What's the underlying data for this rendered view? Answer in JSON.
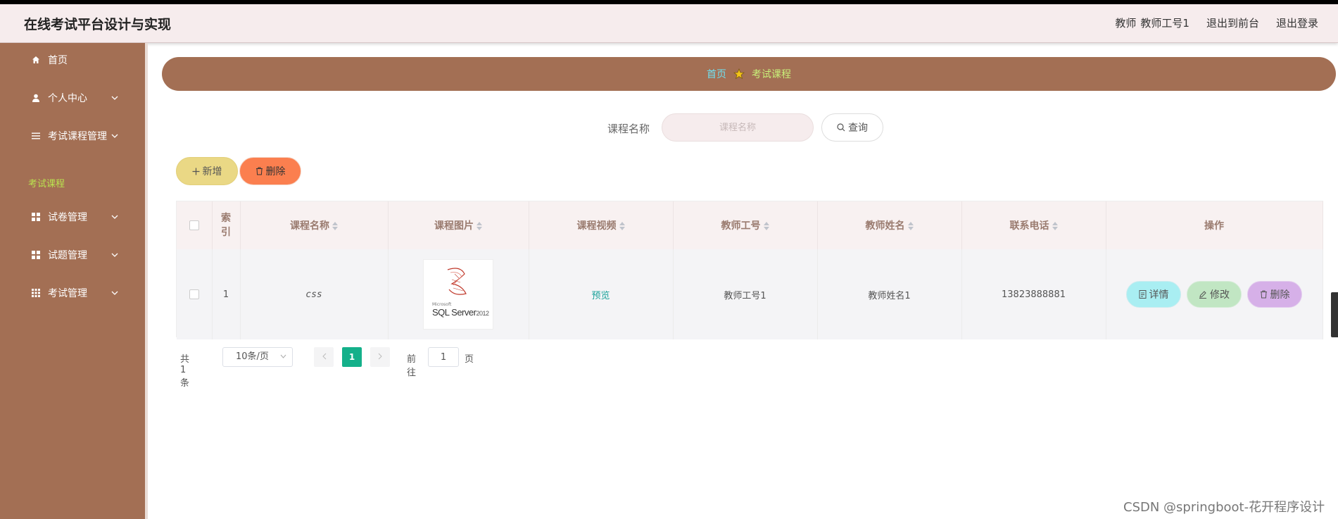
{
  "header": {
    "title": "在线考试平台设计与实现",
    "user_role": "教师",
    "user_name": "教师工号1",
    "back_to_front": "退出到前台",
    "logout": "退出登录"
  },
  "sidebar": {
    "items": [
      {
        "label": "首页",
        "icon": "home-icon"
      },
      {
        "label": "个人中心",
        "icon": "user-icon"
      },
      {
        "label": "考试课程管理",
        "icon": "list-icon"
      },
      {
        "label": "试卷管理",
        "icon": "grid-icon"
      },
      {
        "label": "试题管理",
        "icon": "grid-icon"
      },
      {
        "label": "考试管理",
        "icon": "grid9-icon"
      }
    ],
    "active_sub": "考试课程"
  },
  "breadcrumb": {
    "home": "首页",
    "current": "考试课程"
  },
  "search": {
    "label": "课程名称",
    "placeholder": "课程名称",
    "button": "查询"
  },
  "actions": {
    "add": "新增",
    "delete": "删除"
  },
  "table": {
    "headers": [
      "索引",
      "课程名称",
      "课程图片",
      "课程视频",
      "教师工号",
      "教师姓名",
      "联系电话",
      "操作"
    ],
    "rows": [
      {
        "index": "1",
        "course_name": "css",
        "image_sub": "Microsoft",
        "image_main": "SQL Server",
        "image_ver": "2012",
        "video": "预览",
        "teacher_id": "教师工号1",
        "teacher_name": "教师姓名1",
        "phone": "13823888881",
        "ops": {
          "detail": "详情",
          "edit": "修改",
          "delete": "删除"
        }
      }
    ]
  },
  "pager": {
    "total": "共 1 条",
    "size": "10条/页",
    "current": "1",
    "goto": "前往",
    "goto_value": "1",
    "page_unit": "页"
  },
  "watermark": "CSDN @springboot-花开程序设计",
  "colors": {
    "sidebar": "#a36f54",
    "header": "#f6eced",
    "accent_green": "#14b08a"
  }
}
